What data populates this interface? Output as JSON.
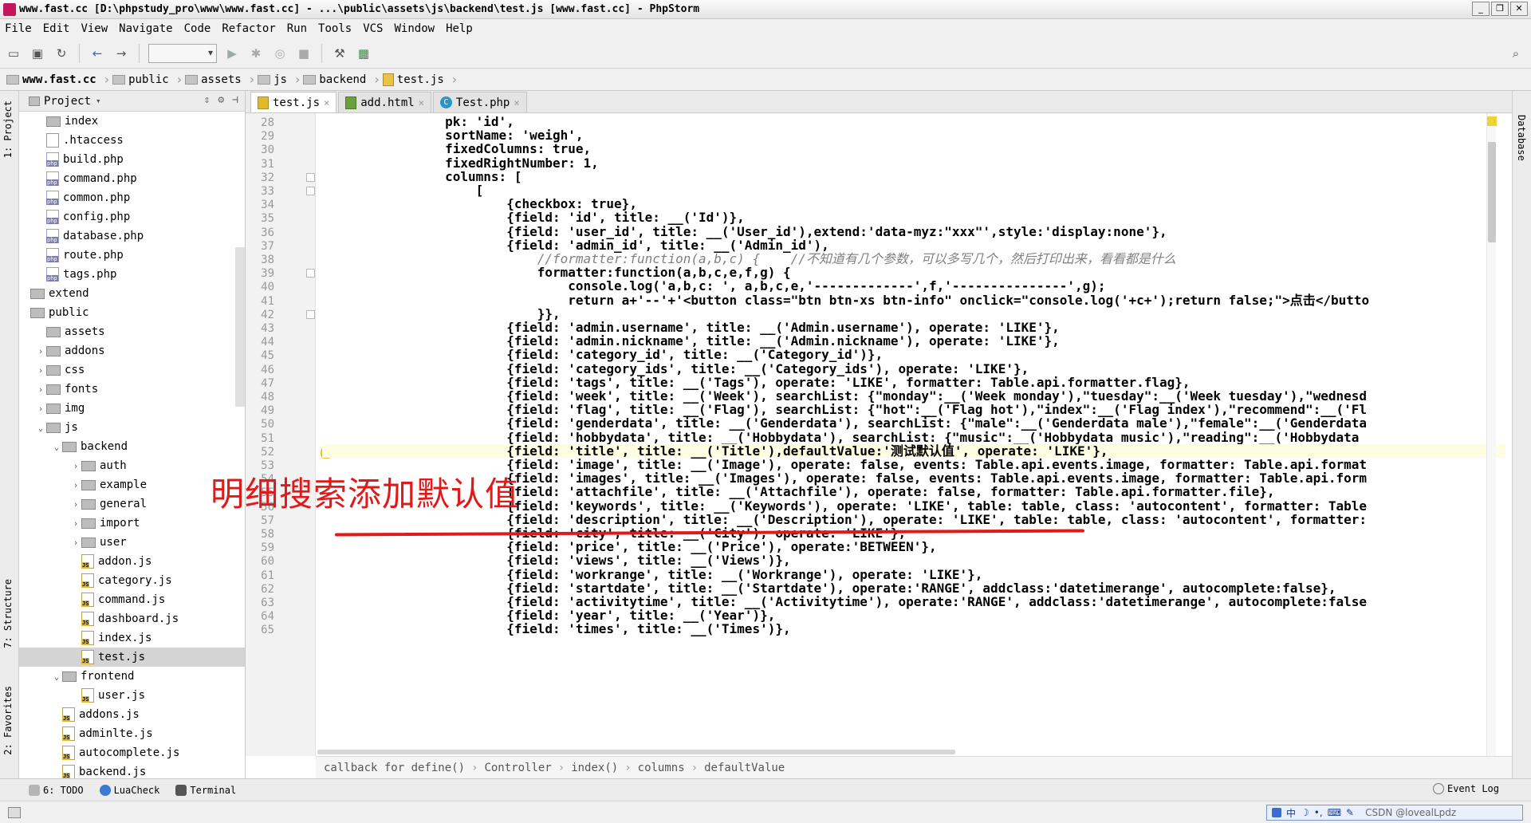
{
  "window": {
    "title": "www.fast.cc [D:\\phpstudy_pro\\www\\www.fast.cc] - ...\\public\\assets\\js\\backend\\test.js [www.fast.cc] - PhpStorm"
  },
  "menu": [
    "File",
    "Edit",
    "View",
    "Navigate",
    "Code",
    "Refactor",
    "Run",
    "Tools",
    "VCS",
    "Window",
    "Help"
  ],
  "breadcrumb": [
    "www.fast.cc",
    "public",
    "assets",
    "js",
    "backend",
    "test.js"
  ],
  "side_strip": {
    "project": "1: Project",
    "structure": "7: Structure",
    "favorites": "2: Favorites",
    "database": "Database"
  },
  "project_panel": {
    "title": "Project",
    "items": [
      {
        "label": "index",
        "type": "folder",
        "depth": 0,
        "arrow": ""
      },
      {
        "label": ".htaccess",
        "type": "file",
        "depth": 0,
        "arrow": ""
      },
      {
        "label": "build.php",
        "type": "php",
        "depth": 0,
        "arrow": ""
      },
      {
        "label": "command.php",
        "type": "php",
        "depth": 0,
        "arrow": ""
      },
      {
        "label": "common.php",
        "type": "php",
        "depth": 0,
        "arrow": ""
      },
      {
        "label": "config.php",
        "type": "php",
        "depth": 0,
        "arrow": ""
      },
      {
        "label": "database.php",
        "type": "php",
        "depth": 0,
        "arrow": ""
      },
      {
        "label": "route.php",
        "type": "php",
        "depth": 0,
        "arrow": ""
      },
      {
        "label": "tags.php",
        "type": "php",
        "depth": 0,
        "arrow": ""
      },
      {
        "label": "extend",
        "type": "folder",
        "depth": -1,
        "arrow": ""
      },
      {
        "label": "public",
        "type": "folder",
        "depth": -1,
        "arrow": ""
      },
      {
        "label": "assets",
        "type": "folder",
        "depth": 0,
        "arrow": ""
      },
      {
        "label": "addons",
        "type": "folder",
        "depth": 1,
        "arrow": ">"
      },
      {
        "label": "css",
        "type": "folder",
        "depth": 1,
        "arrow": ">"
      },
      {
        "label": "fonts",
        "type": "folder",
        "depth": 1,
        "arrow": ">"
      },
      {
        "label": "img",
        "type": "folder",
        "depth": 1,
        "arrow": ">"
      },
      {
        "label": "js",
        "type": "folder",
        "depth": 1,
        "arrow": "v"
      },
      {
        "label": "backend",
        "type": "folder",
        "depth": 2,
        "arrow": "v"
      },
      {
        "label": "auth",
        "type": "folder",
        "depth": 3,
        "arrow": ">"
      },
      {
        "label": "example",
        "type": "folder",
        "depth": 3,
        "arrow": ">"
      },
      {
        "label": "general",
        "type": "folder",
        "depth": 3,
        "arrow": ">"
      },
      {
        "label": "import",
        "type": "folder",
        "depth": 3,
        "arrow": ">"
      },
      {
        "label": "user",
        "type": "folder",
        "depth": 3,
        "arrow": ">"
      },
      {
        "label": "addon.js",
        "type": "js",
        "depth": 3,
        "arrow": ""
      },
      {
        "label": "category.js",
        "type": "js",
        "depth": 3,
        "arrow": ""
      },
      {
        "label": "command.js",
        "type": "js",
        "depth": 3,
        "arrow": ""
      },
      {
        "label": "dashboard.js",
        "type": "js",
        "depth": 3,
        "arrow": ""
      },
      {
        "label": "index.js",
        "type": "js",
        "depth": 3,
        "arrow": ""
      },
      {
        "label": "test.js",
        "type": "js",
        "depth": 3,
        "arrow": "",
        "selected": true
      },
      {
        "label": "frontend",
        "type": "folder",
        "depth": 2,
        "arrow": "v"
      },
      {
        "label": "user.js",
        "type": "js",
        "depth": 3,
        "arrow": ""
      },
      {
        "label": "addons.js",
        "type": "js",
        "depth": 2,
        "arrow": ""
      },
      {
        "label": "adminlte.js",
        "type": "js",
        "depth": 2,
        "arrow": ""
      },
      {
        "label": "autocomplete.js",
        "type": "js",
        "depth": 2,
        "arrow": ""
      },
      {
        "label": "backend.js",
        "type": "js",
        "depth": 2,
        "arrow": ""
      }
    ]
  },
  "tabs": [
    {
      "label": "test.js",
      "kind": "js",
      "active": true
    },
    {
      "label": "add.html",
      "kind": "html",
      "active": false
    },
    {
      "label": "Test.php",
      "kind": "php",
      "active": false
    }
  ],
  "code": {
    "first_line": 28,
    "current_line": 52,
    "lines": [
      {
        "n": 28,
        "text": "                pk: 'id',",
        "fold": false
      },
      {
        "n": 29,
        "text": "                sortName: 'weigh',",
        "fold": false
      },
      {
        "n": 30,
        "text": "                fixedColumns: true,",
        "fold": false
      },
      {
        "n": 31,
        "text": "                fixedRightNumber: 1,",
        "fold": false
      },
      {
        "n": 32,
        "text": "                columns: [",
        "fold": true
      },
      {
        "n": 33,
        "text": "                    [",
        "fold": true
      },
      {
        "n": 34,
        "text": "                        {checkbox: true},",
        "fold": false
      },
      {
        "n": 35,
        "text": "                        {field: 'id', title: __('Id')},",
        "fold": false
      },
      {
        "n": 36,
        "text": "                        {field: 'user_id', title: __('User_id'),extend:'data-myz:\"xxx\"',style:'display:none'},",
        "fold": false
      },
      {
        "n": 37,
        "text": "                        {field: 'admin_id', title: __('Admin_id'),",
        "fold": false
      },
      {
        "n": 38,
        "text": "                            //formatter:function(a,b,c) {    //不知道有几个参数，可以多写几个，然后打印出来，看看都是什么",
        "fold": false,
        "comment": true
      },
      {
        "n": 39,
        "text": "                            formatter:function(a,b,c,e,f,g) {",
        "fold": true
      },
      {
        "n": 40,
        "text": "                                console.log('a,b,c: ', a,b,c,e,'-------------',f,'---------------',g);",
        "fold": false
      },
      {
        "n": 41,
        "text": "                                return a+'--'+'<button class=\"btn btn-xs btn-info\" onclick=\"console.log('+c+');return false;\">点击</butto",
        "fold": false
      },
      {
        "n": 42,
        "text": "                            }},",
        "fold": true
      },
      {
        "n": 43,
        "text": "                        {field: 'admin.username', title: __('Admin.username'), operate: 'LIKE'},",
        "fold": false
      },
      {
        "n": 44,
        "text": "                        {field: 'admin.nickname', title: __('Admin.nickname'), operate: 'LIKE'},",
        "fold": false
      },
      {
        "n": 45,
        "text": "                        {field: 'category_id', title: __('Category_id')},",
        "fold": false
      },
      {
        "n": 46,
        "text": "                        {field: 'category_ids', title: __('Category_ids'), operate: 'LIKE'},",
        "fold": false
      },
      {
        "n": 47,
        "text": "                        {field: 'tags', title: __('Tags'), operate: 'LIKE', formatter: Table.api.formatter.flag},",
        "fold": false
      },
      {
        "n": 48,
        "text": "                        {field: 'week', title: __('Week'), searchList: {\"monday\":__('Week monday'),\"tuesday\":__('Week tuesday'),\"wednesd",
        "fold": false
      },
      {
        "n": 49,
        "text": "                        {field: 'flag', title: __('Flag'), searchList: {\"hot\":__('Flag hot'),\"index\":__('Flag index'),\"recommend\":__('Fl",
        "fold": false
      },
      {
        "n": 50,
        "text": "                        {field: 'genderdata', title: __('Genderdata'), searchList: {\"male\":__('Genderdata male'),\"female\":__('Genderdata",
        "fold": false
      },
      {
        "n": 51,
        "text": "                        {field: 'hobbydata', title: __('Hobbydata'), searchList: {\"music\":__('Hobbydata music'),\"reading\":__('Hobbydata",
        "fold": false
      },
      {
        "n": 52,
        "text": "                        {field: 'title', title: __('Title'),defaultValue:'测试默认值', operate: 'LIKE'},",
        "fold": false
      },
      {
        "n": 53,
        "text": "                        {field: 'image', title: __('Image'), operate: false, events: Table.api.events.image, formatter: Table.api.format",
        "fold": false
      },
      {
        "n": 54,
        "text": "                        {field: 'images', title: __('Images'), operate: false, events: Table.api.events.image, formatter: Table.api.form",
        "fold": false
      },
      {
        "n": 55,
        "text": "                        {field: 'attachfile', title: __('Attachfile'), operate: false, formatter: Table.api.formatter.file},",
        "fold": false
      },
      {
        "n": 56,
        "text": "                        {field: 'keywords', title: __('Keywords'), operate: 'LIKE', table: table, class: 'autocontent', formatter: Table",
        "fold": false
      },
      {
        "n": 57,
        "text": "                        {field: 'description', title: __('Description'), operate: 'LIKE', table: table, class: 'autocontent', formatter:",
        "fold": false
      },
      {
        "n": 58,
        "text": "                        {field: 'city', title: __('City'), operate: 'LIKE'},",
        "fold": false
      },
      {
        "n": 59,
        "text": "                        {field: 'price', title: __('Price'), operate:'BETWEEN'},",
        "fold": false
      },
      {
        "n": 60,
        "text": "                        {field: 'views', title: __('Views')},",
        "fold": false
      },
      {
        "n": 61,
        "text": "                        {field: 'workrange', title: __('Workrange'), operate: 'LIKE'},",
        "fold": false
      },
      {
        "n": 62,
        "text": "                        {field: 'startdate', title: __('Startdate'), operate:'RANGE', addclass:'datetimerange', autocomplete:false},",
        "fold": false
      },
      {
        "n": 63,
        "text": "                        {field: 'activitytime', title: __('Activitytime'), operate:'RANGE', addclass:'datetimerange', autocomplete:false",
        "fold": false
      },
      {
        "n": 64,
        "text": "                        {field: 'year', title: __('Year')},",
        "fold": false
      },
      {
        "n": 65,
        "text": "                        {field: 'times', title: __('Times')},",
        "fold": false
      }
    ]
  },
  "code_breadcrumb": [
    "callback for define()",
    "Controller",
    "index()",
    "columns",
    "defaultValue"
  ],
  "annotation": "明细搜索添加默认值",
  "bottom_tools": {
    "todo": "6: TODO",
    "luacheck": "LuaCheck",
    "terminal": "Terminal",
    "event_log": "Event Log"
  },
  "status": {
    "ime_label": "中",
    "watermark": "CSDN @lovealLpdz"
  },
  "colors": {
    "annotation": "#e01a1a",
    "current_line": "#fffde1",
    "selected_tree": "#d4d4d4"
  }
}
